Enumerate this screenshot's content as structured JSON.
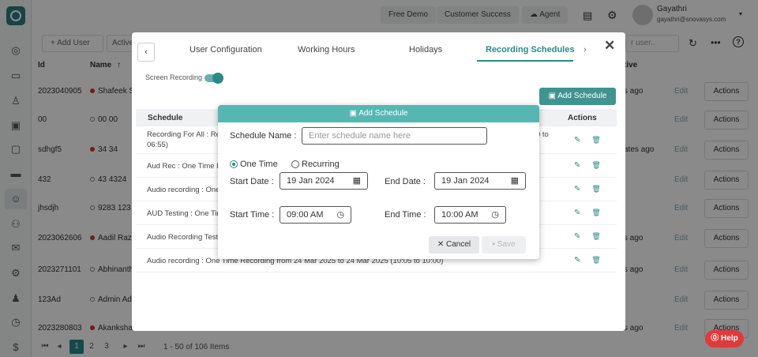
{
  "topbar": {
    "free_demo": "Free Demo",
    "customer_success": "Customer Success",
    "agent": "Agent",
    "user_name": "Gayathri",
    "user_email": "gayathri@snovasys.com",
    "search_placeholder": "r user.."
  },
  "toolbar": {
    "add_user": "Add User",
    "active": "Active"
  },
  "table": {
    "headers": {
      "id": "Id",
      "name": "Name",
      "active": "tive"
    },
    "rows": [
      {
        "id": "2023040905",
        "name": "Shafeek S",
        "dot": "red",
        "last": "s ago"
      },
      {
        "id": "00",
        "name": "00 00",
        "dot": "ring",
        "last": ""
      },
      {
        "id": "sdhgf5",
        "name": "34 34",
        "dot": "red",
        "last": "ates ago"
      },
      {
        "id": "432",
        "name": "43 4324",
        "dot": "ring",
        "last": ""
      },
      {
        "id": "jhsdjh",
        "name": "9283 123",
        "dot": "ring",
        "last": ""
      },
      {
        "id": "2023062606",
        "name": "Aadil Raza",
        "dot": "red",
        "last": "s ago"
      },
      {
        "id": "2023271101",
        "name": "Abhinanth",
        "dot": "ring",
        "last": "s ago"
      },
      {
        "id": "123Ad",
        "name": "Admin Ad",
        "dot": "ring",
        "last": ""
      },
      {
        "id": "2023280803",
        "name": "Akanksha",
        "dot": "red",
        "last": "s ago"
      }
    ],
    "edit_label": "Edit",
    "actions_label": "Actions"
  },
  "pagination": {
    "pages": [
      "1",
      "2",
      "3"
    ],
    "summary": "1 - 50 of 106 Items"
  },
  "config_modal": {
    "tabs": [
      "User Configuration",
      "Working Hours",
      "Holidays",
      "Recording Schedules"
    ],
    "active_tab": "Recording Schedules",
    "screen_recording_label": "Screen Recording",
    "add_schedule_button": "Add Schedule",
    "table_headers": {
      "schedule": "Schedule",
      "actions": "Actions"
    },
    "schedules": [
      {
        "text": "Recording For All : Rec",
        "overflow": "0 to",
        "second": "06:55)"
      },
      {
        "text": "Aud Rec : One Time Re",
        "overflow": "",
        "second": ""
      },
      {
        "text": "Audio recording : One T",
        "overflow": "",
        "second": ""
      },
      {
        "text": "AUD Testing : One Tim",
        "overflow": "",
        "second": ""
      },
      {
        "text": "Audio Recording Testin",
        "overflow": "",
        "second": ""
      },
      {
        "text": "Audio recording : One Time Recording from 24 Mar 2025 to 24 Mar 2025 (10:05 to 10:00)",
        "overflow": "",
        "second": ""
      }
    ]
  },
  "dialog": {
    "title": "Add Schedule",
    "schedule_name_label": "Schedule Name :",
    "schedule_name_placeholder": "Enter schedule name here",
    "one_time_label": "One Time",
    "recurring_label": "Recurring",
    "start_date_label": "Start Date :",
    "start_date_value": "19 Jan 2024",
    "end_date_label": "End Date :",
    "end_date_value": "19 Jan 2024",
    "start_time_label": "Start Time :",
    "start_time_value": "09:00 AM",
    "end_time_label": "End Time :",
    "end_time_value": "10:00 AM",
    "cancel_label": "Cancel",
    "save_label": "Save"
  },
  "help": {
    "label": "Help"
  },
  "colors": {
    "accent": "#2a8a8a",
    "dialog_header": "#56b6b2",
    "help": "#e03a3a"
  }
}
